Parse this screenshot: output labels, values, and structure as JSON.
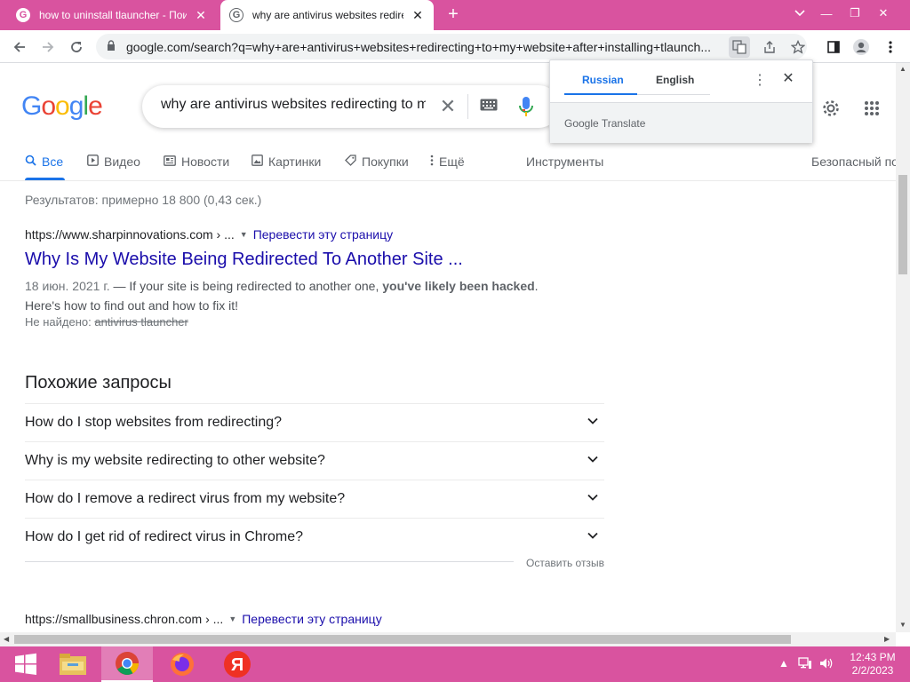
{
  "tabs": [
    {
      "title": "how to uninstall tlauncher - Поис",
      "favicon": "G"
    },
    {
      "title": "why are antivirus websites redire",
      "favicon": "G"
    }
  ],
  "window": {
    "close": "✕",
    "minimize": "—",
    "restore": "❐"
  },
  "address": {
    "url": "google.com/search?q=why+are+antivirus+websites+redirecting+to+my+website+after+installing+tlaunch..."
  },
  "search": {
    "query": "why are antivirus websites redirecting to my website after installing tlauncher",
    "logo_letters": [
      {
        "ch": "G",
        "color": "#4285F4"
      },
      {
        "ch": "o",
        "color": "#EA4335"
      },
      {
        "ch": "o",
        "color": "#FBBC05"
      },
      {
        "ch": "g",
        "color": "#4285F4"
      },
      {
        "ch": "l",
        "color": "#34A853"
      },
      {
        "ch": "e",
        "color": "#EA4335"
      }
    ]
  },
  "nav": {
    "all": "Все",
    "video": "Видео",
    "news": "Новости",
    "images": "Картинки",
    "shopping": "Покупки",
    "more": "Ещё",
    "tools": "Инструменты",
    "safe": "Безопасный поиск"
  },
  "stats": "Результатов: примерно 18 800 (0,43 сек.)",
  "result1": {
    "cite": "https://www.sharpinnovations.com › ...",
    "translate": "Перевести эту страницу",
    "title": "Why Is My Website Being Redirected To Another Site ...",
    "date": "18 июн. 2021 г.",
    "snippet_pre": " — If your site is being redirected to another one, ",
    "snippet_bold": "you've likely been hacked",
    "snippet_post": ".",
    "snippet_line2": "Here's how to find out and how to fix it!",
    "missing_label": "Не найдено: ",
    "missing_terms": "antivirus tlauncher"
  },
  "related": {
    "title": "Похожие запросы",
    "items": [
      "How do I stop websites from redirecting?",
      "Why is my website redirecting to other website?",
      "How do I remove a redirect virus from my website?",
      "How do I get rid of redirect virus in Chrome?"
    ],
    "feedback": "Оставить отзыв"
  },
  "result2": {
    "cite": "https://smallbusiness.chron.com › ...",
    "translate": "Перевести эту страницу"
  },
  "translate_popup": {
    "lang_selected": "Russian",
    "lang_other": "English",
    "brand": "Google Translate"
  },
  "taskbar": {
    "time": "12:43 PM",
    "date": "2/2/2023",
    "yandex": "Я"
  }
}
